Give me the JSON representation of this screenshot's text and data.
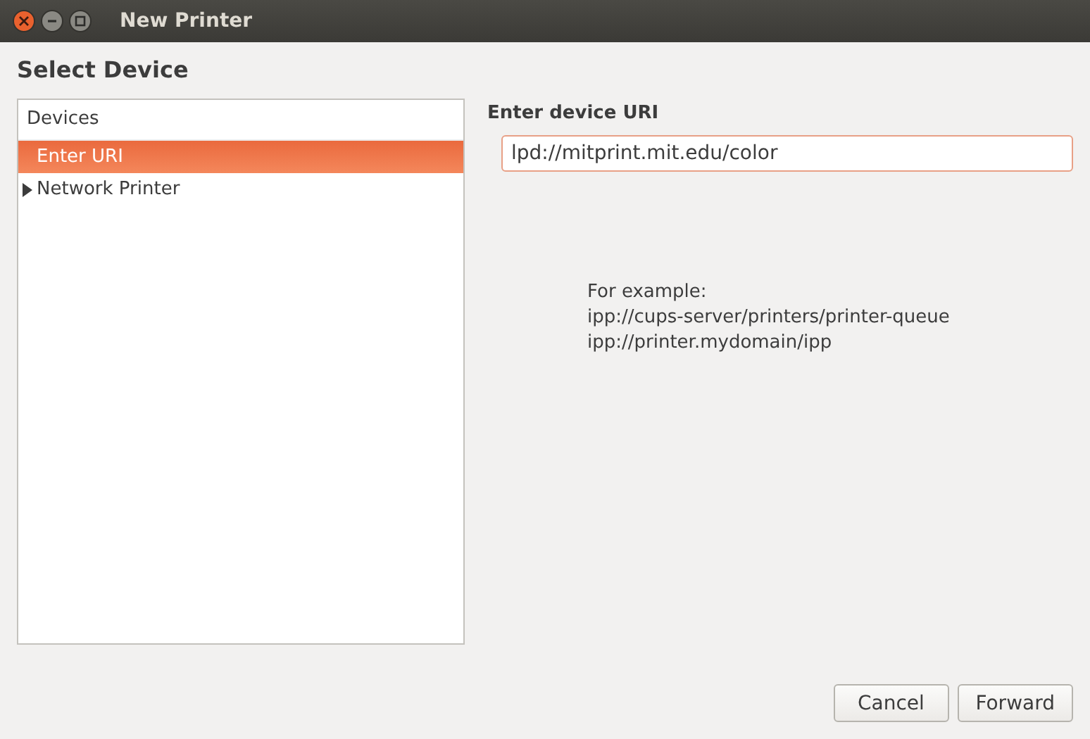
{
  "window": {
    "title": "New Printer"
  },
  "heading": "Select Device",
  "devices": {
    "header": "Devices",
    "items": [
      {
        "label": "Enter URI",
        "selected": true
      },
      {
        "label": "Network Printer",
        "selected": false,
        "expanded": false
      }
    ]
  },
  "uri": {
    "label": "Enter device URI",
    "value": "lpd://mitprint.mit.edu/color"
  },
  "example": [
    "For example:",
    "ipp://cups-server/printers/printer-queue",
    "ipp://printer.mydomain/ipp"
  ],
  "buttons": [
    "Cancel",
    "Forward"
  ]
}
